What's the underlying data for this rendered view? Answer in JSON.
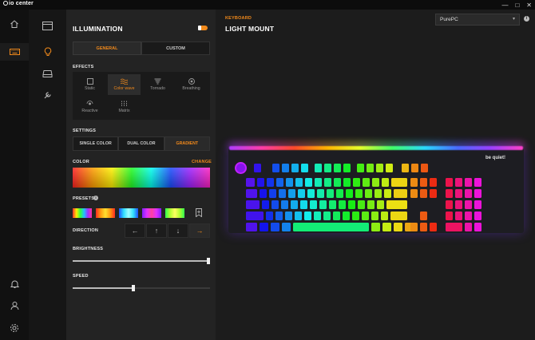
{
  "app": {
    "logo_text": "io center",
    "window_controls": [
      "—",
      "□",
      "✕"
    ]
  },
  "rail": {
    "items": [
      {
        "icon": "home-icon",
        "active": false
      },
      {
        "icon": "keyboard-icon",
        "active": true
      },
      {
        "icon": "bell-icon",
        "active": false
      },
      {
        "icon": "user-icon",
        "active": false
      },
      {
        "icon": "settings-icon",
        "active": false
      }
    ]
  },
  "subnav": {
    "items": [
      {
        "icon": "device-icon",
        "active": false
      },
      {
        "icon": "bulb-icon",
        "active": true
      },
      {
        "icon": "drive-icon",
        "active": false
      },
      {
        "icon": "wrench-icon",
        "active": false
      }
    ]
  },
  "panel": {
    "title": "ILLUMINATION",
    "toggle_on": true,
    "tabs": [
      {
        "label": "GENERAL",
        "active": true
      },
      {
        "label": "CUSTOM",
        "active": false
      }
    ],
    "effects_label": "EFFECTS",
    "effects": [
      {
        "label": "Static",
        "icon": "square-icon",
        "active": false
      },
      {
        "label": "Color wave",
        "icon": "wave-icon",
        "active": true
      },
      {
        "label": "Tornado",
        "icon": "tornado-icon",
        "active": false
      },
      {
        "label": "Breathing",
        "icon": "breathing-icon",
        "active": false
      },
      {
        "label": "Reactive",
        "icon": "reactive-icon",
        "active": false
      },
      {
        "label": "Matrix",
        "icon": "matrix-icon",
        "active": false
      }
    ],
    "settings_label": "SETTINGS",
    "settings": [
      {
        "label": "SINGLE COLOR",
        "active": false
      },
      {
        "label": "DUAL COLOR",
        "active": false
      },
      {
        "label": "GRADIENT",
        "active": true
      }
    ],
    "color_label": "COLOR",
    "change_label": "CHANGE",
    "presets_label": "PRESETS",
    "direction_label": "DIRECTION",
    "directions": [
      {
        "glyph": "←",
        "active": false
      },
      {
        "glyph": "↑",
        "active": false
      },
      {
        "glyph": "↓",
        "active": false
      },
      {
        "glyph": "→",
        "active": true
      }
    ],
    "brightness_label": "BRIGHTNESS",
    "brightness_value": 1.0,
    "speed_label": "SPEED",
    "speed_value": 0.44
  },
  "main": {
    "breadcrumb": "KEYBOARD",
    "title": "LIGHT MOUNT",
    "device_select": "PurePC",
    "info_glyph": "i",
    "keyboard_brand": "be quiet!",
    "colors": {
      "accent": "#f28a1b"
    }
  }
}
